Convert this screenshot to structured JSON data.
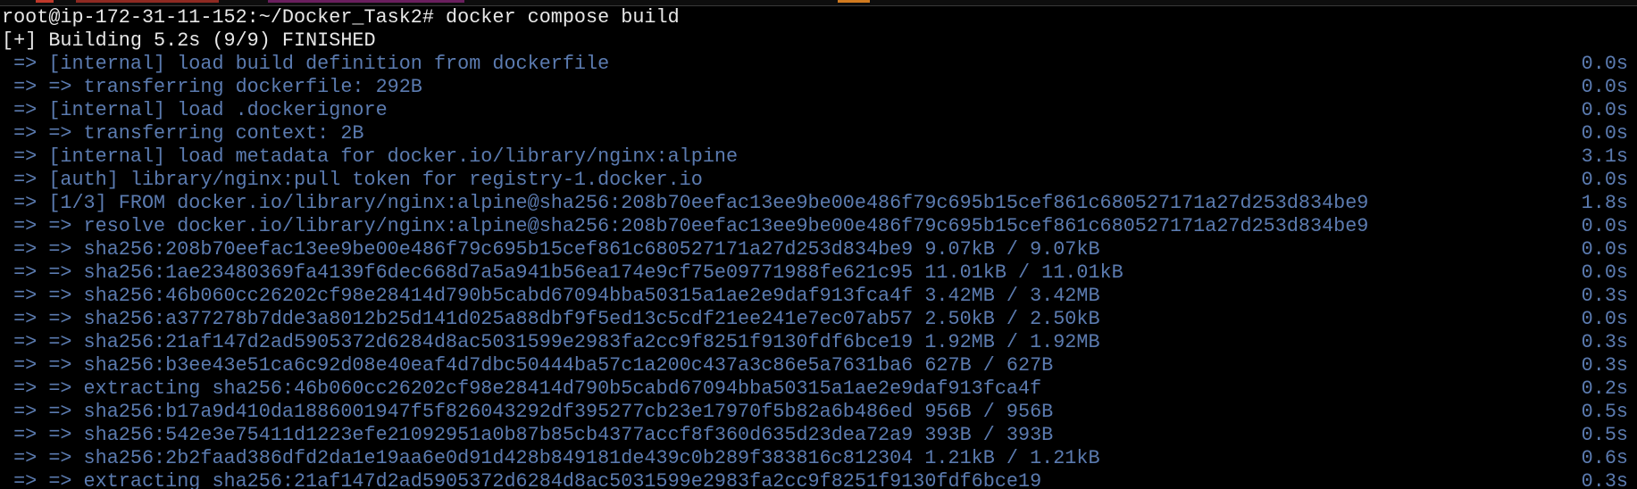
{
  "prompt": "root@ip-172-31-11-152:~/Docker_Task2# docker compose build",
  "summary": "[+] Building 5.2s (9/9) FINISHED",
  "steps": [
    {
      "text": " => [internal] load build definition from dockerfile",
      "time": "0.0s"
    },
    {
      "text": " => => transferring dockerfile: 292B",
      "time": "0.0s"
    },
    {
      "text": " => [internal] load .dockerignore",
      "time": "0.0s"
    },
    {
      "text": " => => transferring context: 2B",
      "time": "0.0s"
    },
    {
      "text": " => [internal] load metadata for docker.io/library/nginx:alpine",
      "time": "3.1s"
    },
    {
      "text": " => [auth] library/nginx:pull token for registry-1.docker.io",
      "time": "0.0s"
    },
    {
      "text": " => [1/3] FROM docker.io/library/nginx:alpine@sha256:208b70eefac13ee9be00e486f79c695b15cef861c680527171a27d253d834be9",
      "time": "1.8s"
    },
    {
      "text": " => => resolve docker.io/library/nginx:alpine@sha256:208b70eefac13ee9be00e486f79c695b15cef861c680527171a27d253d834be9",
      "time": "0.0s"
    },
    {
      "text": " => => sha256:208b70eefac13ee9be00e486f79c695b15cef861c680527171a27d253d834be9 9.07kB / 9.07kB",
      "time": "0.0s"
    },
    {
      "text": " => => sha256:1ae23480369fa4139f6dec668d7a5a941b56ea174e9cf75e09771988fe621c95 11.01kB / 11.01kB",
      "time": "0.0s"
    },
    {
      "text": " => => sha256:46b060cc26202cf98e28414d790b5cabd67094bba50315a1ae2e9daf913fca4f 3.42MB / 3.42MB",
      "time": "0.3s"
    },
    {
      "text": " => => sha256:a377278b7dde3a8012b25d141d025a88dbf9f5ed13c5cdf21ee241e7ec07ab57 2.50kB / 2.50kB",
      "time": "0.0s"
    },
    {
      "text": " => => sha256:21af147d2ad5905372d6284d8ac5031599e2983fa2cc9f8251f9130fdf6bce19 1.92MB / 1.92MB",
      "time": "0.3s"
    },
    {
      "text": " => => sha256:b3ee43e51ca6c92d08e40eaf4d7dbc50444ba57c1a200c437a3c86e5a7631ba6 627B / 627B",
      "time": "0.3s"
    },
    {
      "text": " => => extracting sha256:46b060cc26202cf98e28414d790b5cabd67094bba50315a1ae2e9daf913fca4f",
      "time": "0.2s"
    },
    {
      "text": " => => sha256:b17a9d410da1886001947f5f826043292df395277cb23e17970f5b82a6b486ed 956B / 956B",
      "time": "0.5s"
    },
    {
      "text": " => => sha256:542e3e75411d1223efe21092951a0b87b85cb4377accf8f360d635d23dea72a9 393B / 393B",
      "time": "0.5s"
    },
    {
      "text": " => => sha256:2b2faad386dfd2da1e19aa6e0d91d428b849181de439c0b289f383816c812304 1.21kB / 1.21kB",
      "time": "0.6s"
    },
    {
      "text": " => => extracting sha256:21af147d2ad5905372d6284d8ac5031599e2983fa2cc9f8251f9130fdf6bce19",
      "time": "0.3s"
    }
  ]
}
